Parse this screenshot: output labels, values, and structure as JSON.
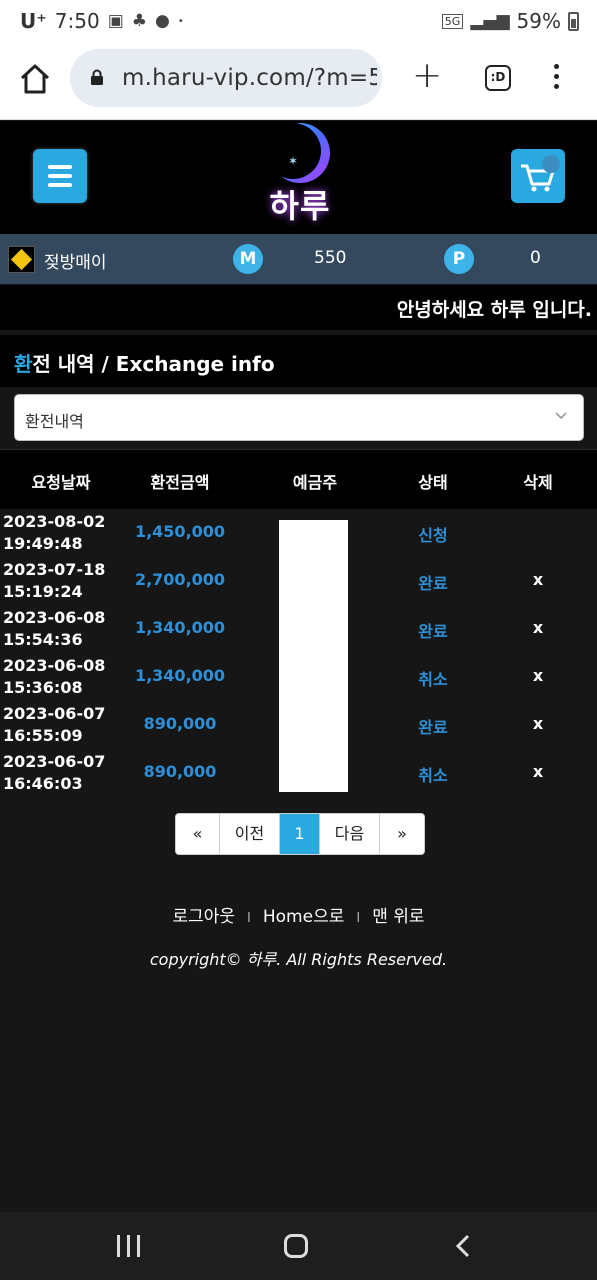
{
  "status_bar": {
    "carrier": "U⁺",
    "time": "7:50",
    "network": "5G",
    "battery": "59%",
    "icons": [
      "image-icon",
      "kids-icon",
      "talk-icon",
      "dot-icon",
      "signal-icon",
      "battery-icon"
    ]
  },
  "browser": {
    "url": "m.haru-vip.com/?m=5",
    "tabs_label": ":D",
    "icons": [
      "home-icon",
      "lock-icon",
      "plus-icon",
      "tabs-icon",
      "menu-dots-icon"
    ]
  },
  "header": {
    "logo_text": "하루",
    "icons": [
      "hamburger-icon",
      "cart-icon",
      "moon-logo"
    ]
  },
  "user": {
    "name": "젖방매이",
    "m_label": "M",
    "m_value": "550",
    "p_label": "P",
    "p_value": "0"
  },
  "greeting": "안녕하세요 하루 입니다.",
  "page": {
    "title_accent": "환",
    "title_rest": "전 내역 / Exchange info",
    "select_value": "환전내역"
  },
  "table": {
    "headers": [
      "요청날짜",
      "환전금액",
      "예금주",
      "상태",
      "삭제"
    ],
    "rows": [
      {
        "date": "2023-08-02 19:49:48",
        "amount": "1,450,000",
        "status": "신청",
        "delete": ""
      },
      {
        "date": "2023-07-18 15:19:24",
        "amount": "2,700,000",
        "status": "완료",
        "delete": "x"
      },
      {
        "date": "2023-06-08 15:54:36",
        "amount": "1,340,000",
        "status": "완료",
        "delete": "x"
      },
      {
        "date": "2023-06-08 15:36:08",
        "amount": "1,340,000",
        "status": "취소",
        "delete": "x"
      },
      {
        "date": "2023-06-07 16:55:09",
        "amount": "890,000",
        "status": "완료",
        "delete": "x"
      },
      {
        "date": "2023-06-07 16:46:03",
        "amount": "890,000",
        "status": "취소",
        "delete": "x"
      }
    ]
  },
  "pagination": {
    "first": "«",
    "prev": "이전",
    "current": "1",
    "next": "다음",
    "last": "»"
  },
  "footer": {
    "logout": "로그아웃",
    "home": "Home으로",
    "top": "맨 위로",
    "separator": "I",
    "copyright": "copyright© 하루. All Rights Reserved."
  },
  "colors": {
    "accent": "#2aa9e0",
    "amount_blue": "#2e8fd6",
    "userbar": "#34495e",
    "page_bg": "#161616"
  }
}
